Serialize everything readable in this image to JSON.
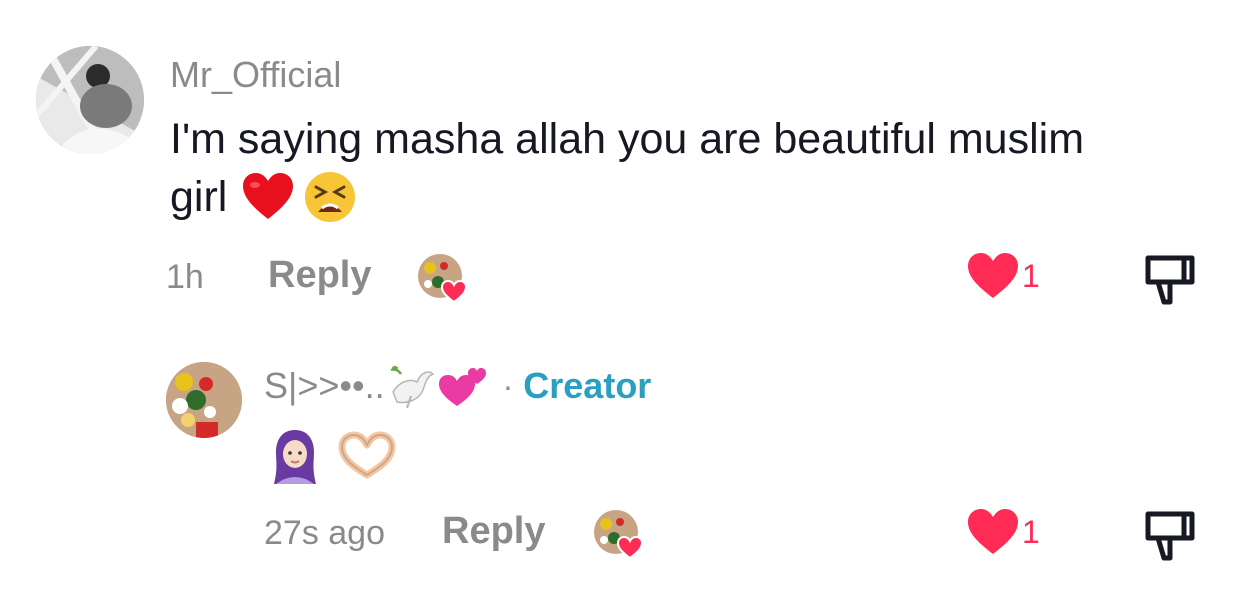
{
  "comment": {
    "username": "Mr_Official",
    "text_line1": "I'm saying masha allah you are beautiful muslim",
    "text_line2": "girl",
    "text_emojis": [
      "red-heart-icon",
      "tired-face-icon"
    ],
    "time": "1h",
    "reply_label": "Reply",
    "like_count": "1"
  },
  "reply": {
    "username": "S|>>••..",
    "username_emojis": [
      "dove-icon",
      "two-hearts-icon"
    ],
    "separator": "·",
    "creator_label": "Creator",
    "text_emojis": [
      "woman-with-headscarf-icon",
      "heart-hands-icon"
    ],
    "time": "27s ago",
    "reply_label": "Reply",
    "like_count": "1"
  },
  "colors": {
    "like_red": "#fe2c55",
    "creator_blue": "#2a9fc0",
    "muted_gray": "#8a8a8a",
    "text_dark": "#161823"
  }
}
